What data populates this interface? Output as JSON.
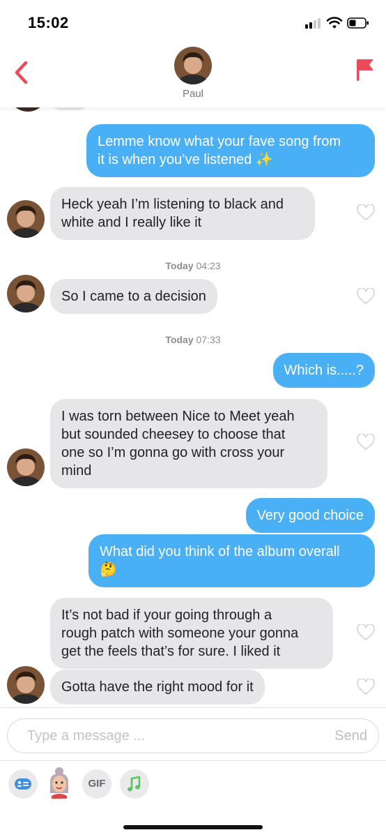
{
  "status_bar": {
    "time": "15:02"
  },
  "header": {
    "contact_name": "Paul"
  },
  "messages": [
    {
      "direction": "out",
      "lines": [
        "Lemme know what your fave song from",
        "it is when you’ve listened ✨"
      ]
    },
    {
      "direction": "in",
      "lines": [
        "Heck yeah I’m listening to black and",
        "white and I really like it"
      ]
    },
    {
      "direction": "in",
      "lines": [
        "So I came to a decision"
      ]
    },
    {
      "direction": "out",
      "lines": [
        "Which is.....?"
      ]
    },
    {
      "direction": "in",
      "lines": [
        "I was torn between Nice to Meet yeah",
        "but sounded cheesey to choose that",
        "one so I’m gonna go with cross your",
        "mind"
      ]
    },
    {
      "direction": "out",
      "lines": [
        "Very good choice"
      ]
    },
    {
      "direction": "out",
      "lines": [
        "What did you think of the album overall",
        "🤔"
      ]
    },
    {
      "direction": "in",
      "lines": [
        "It’s not bad if your going through a",
        "rough patch with someone your gonna",
        "get the feels that’s for sure. I liked it"
      ]
    },
    {
      "direction": "in",
      "lines": [
        "Gotta have the right mood for it"
      ]
    }
  ],
  "timestamps": [
    {
      "day": "Today",
      "time": "04:23"
    },
    {
      "day": "Today",
      "time": "07:33"
    }
  ],
  "composer": {
    "placeholder": "Type a message ...",
    "send_label": "Send"
  },
  "toolbar": {
    "gif_label": "GIF"
  },
  "colors": {
    "accent": "#ea4a5a",
    "outgoing_bubble": "#4ab0f5",
    "incoming_bubble": "#e6e6e9",
    "music_icon": "#5cc45c"
  },
  "icons": [
    "back-chevron-icon",
    "flag-icon",
    "heart-icon",
    "sticker-icon",
    "bitmoji-icon",
    "gif-icon",
    "music-note-icon"
  ]
}
